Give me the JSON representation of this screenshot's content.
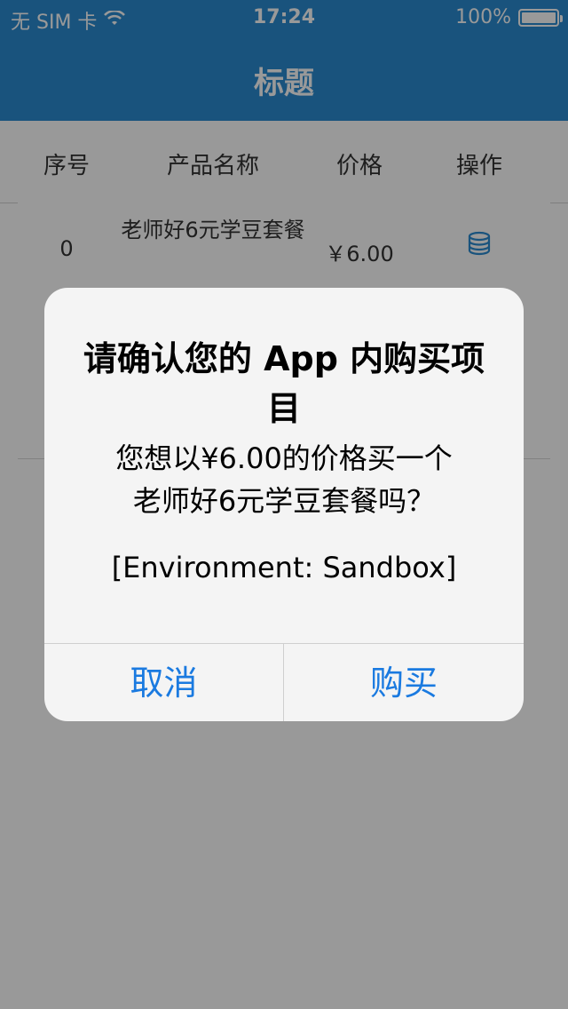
{
  "status_bar": {
    "carrier": "无 SIM 卡",
    "time": "17:24",
    "battery": "100%"
  },
  "nav": {
    "title": "标题"
  },
  "table": {
    "headers": [
      "序号",
      "产品名称",
      "价格",
      "操作"
    ],
    "rows": [
      {
        "index": "0",
        "name": "老师好6元学豆套餐",
        "price": "￥6.00",
        "action_icon": "database-icon"
      }
    ]
  },
  "alert": {
    "title": "请确认您的 App 内购买项目",
    "message": "您想以¥6.00的价格买一个\n老师好6元学豆套餐吗？",
    "environment": "[Environment: Sandbox]",
    "cancel_label": "取消",
    "buy_label": "购买"
  },
  "colors": {
    "nav_bg": "#2a8ad0",
    "link_blue": "#1a7ae0"
  }
}
